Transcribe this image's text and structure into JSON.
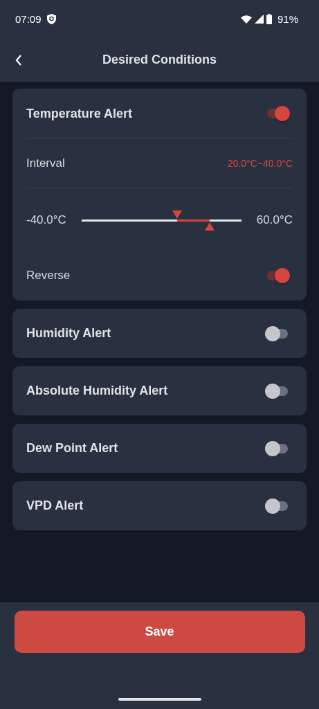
{
  "status_bar": {
    "time": "07:09",
    "battery": "91%"
  },
  "header": {
    "title": "Desired Conditions"
  },
  "alerts": [
    {
      "kind": "expanded",
      "title": "Temperature Alert",
      "on": true,
      "interval_label": "Interval",
      "interval_value": "20.0°C~40.0°C",
      "min_label": "-40.0°C",
      "max_label": "60.0°C",
      "thumbs": [
        {
          "level": 0.6
        },
        {
          "level": 0.8
        }
      ],
      "reverse_label": "Reverse",
      "reverse_on": true
    },
    {
      "kind": "simple",
      "title": "Humidity Alert",
      "on": false
    },
    {
      "kind": "simple",
      "title": "Absolute Humidity Alert",
      "on": false
    },
    {
      "kind": "simple",
      "title": "Dew Point Alert",
      "on": false
    },
    {
      "kind": "simple",
      "title": "VPD Alert",
      "on": false
    }
  ],
  "save_button": "Save"
}
